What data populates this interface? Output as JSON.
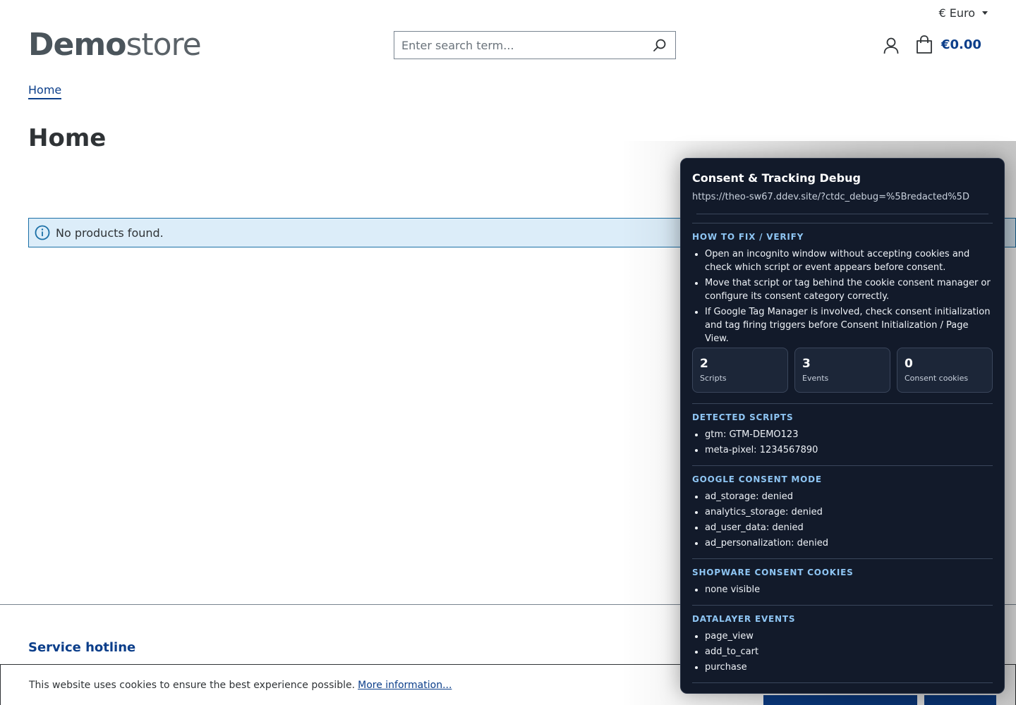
{
  "topbar": {
    "currency": "€ Euro"
  },
  "logo": {
    "bold": "Demo",
    "light": "store"
  },
  "search": {
    "placeholder": "Enter search term..."
  },
  "cart": {
    "price": "€0.00"
  },
  "breadcrumb": {
    "home": "Home"
  },
  "page": {
    "title": "Home",
    "alert": "No products found."
  },
  "footer": {
    "heading": "Service hotline"
  },
  "cookie": {
    "message": "This website uses cookies to ensure the best experience possible.",
    "link": "More information..."
  },
  "debug": {
    "title": "Consent & Tracking Debug",
    "url": "https://theo-sw67.ddev.site/?ctdc_debug=%5Bredacted%5D",
    "fix": {
      "title": "HOW TO FIX / VERIFY",
      "items": [
        "Open an incognito window without accepting cookies and check which script or event appears before consent.",
        "Move that script or tag behind the cookie consent manager or configure its consent category correctly.",
        "If Google Tag Manager is involved, check consent initialization and tag firing triggers before Consent Initialization / Page View."
      ]
    },
    "stats": [
      {
        "num": "2",
        "label": "Scripts"
      },
      {
        "num": "3",
        "label": "Events"
      },
      {
        "num": "0",
        "label": "Consent cookies"
      }
    ],
    "scripts": {
      "title": "DETECTED SCRIPTS",
      "items": [
        "gtm: GTM-DEMO123",
        "meta-pixel: 1234567890"
      ]
    },
    "consent_mode": {
      "title": "GOOGLE CONSENT MODE",
      "items": [
        "ad_storage: denied",
        "analytics_storage: denied",
        "ad_user_data: denied",
        "ad_personalization: denied"
      ]
    },
    "cookies": {
      "title": "SHOPWARE CONSENT COOKIES",
      "items": [
        "none visible"
      ]
    },
    "events": {
      "title": "DATALAYER EVENTS",
      "items": [
        "page_view",
        "add_to_cart",
        "purchase"
      ]
    }
  }
}
